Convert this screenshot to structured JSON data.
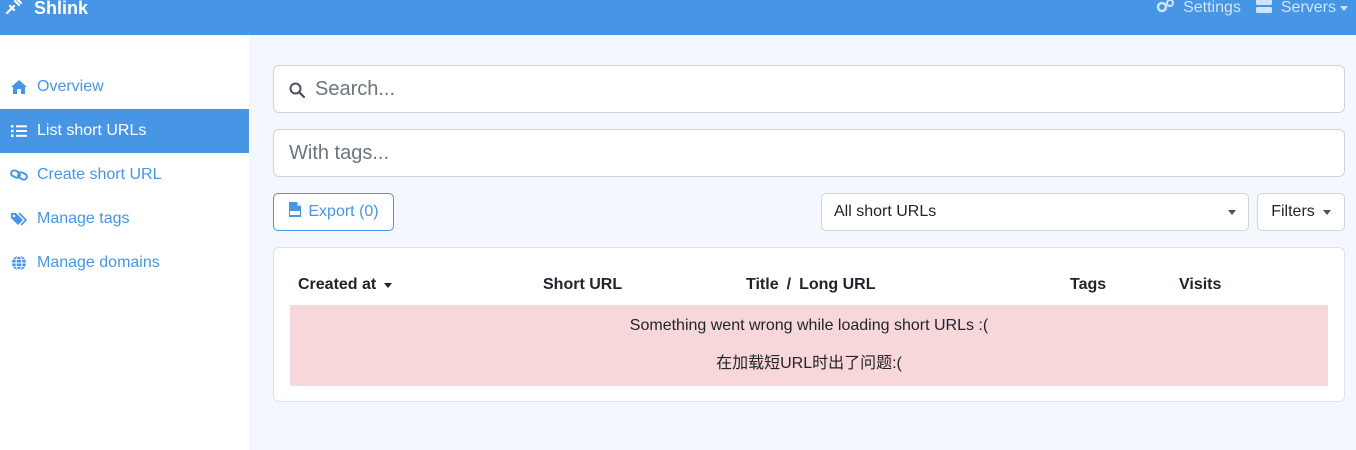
{
  "navbar": {
    "brand": "Shlink",
    "settings_label": "Settings",
    "servers_label": "Servers",
    "bg_color": "#4696e5"
  },
  "sidebar": {
    "items": [
      {
        "label": "Overview",
        "icon": "home-icon",
        "active": false
      },
      {
        "label": "List short URLs",
        "icon": "list-icon",
        "active": true
      },
      {
        "label": "Create short URL",
        "icon": "link-icon",
        "active": false
      },
      {
        "label": "Manage tags",
        "icon": "tags-icon",
        "active": false
      },
      {
        "label": "Manage domains",
        "icon": "globe-icon",
        "active": false
      }
    ]
  },
  "search": {
    "placeholder": "Search..."
  },
  "tags": {
    "placeholder": "With tags..."
  },
  "toolbar": {
    "export_label": "Export (0)",
    "select_value": "All short URLs",
    "filters_label": "Filters"
  },
  "table": {
    "headers": {
      "created_at": "Created at",
      "short_url": "Short URL",
      "title": "Title",
      "separator": "/",
      "long_url": "Long URL",
      "tags": "Tags",
      "visits": "Visits"
    },
    "error_message": "Something went wrong while loading short URLs :(",
    "error_message_zh": "在加载短URL时出了问题:("
  }
}
